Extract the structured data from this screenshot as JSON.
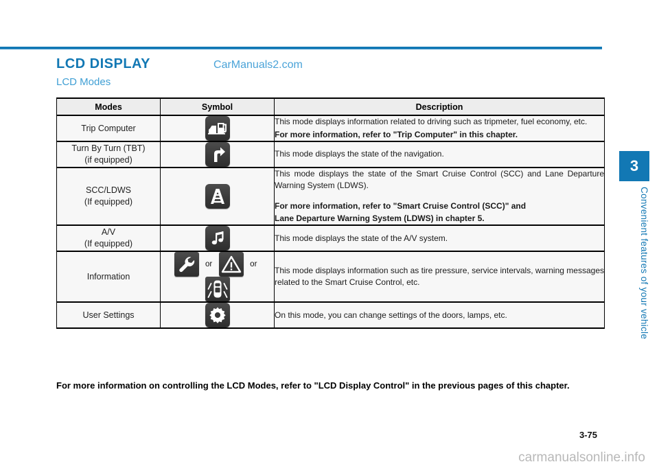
{
  "header": {
    "main_title": "LCD DISPLAY",
    "sub_title": "LCD Modes",
    "watermark_top": "CarManuals2.com",
    "accent_color": "#1278b4"
  },
  "table": {
    "columns": [
      "Modes",
      "Symbol",
      "Description"
    ],
    "rows": [
      {
        "mode": "Trip Computer",
        "mode_sub": "",
        "symbols": [
          "fuel-pump-icon"
        ],
        "desc_lines": [
          {
            "text": "This mode displays information related to driving such as tripmeter, fuel economy, etc.",
            "bold": false
          },
          {
            "text": "For more information, refer to \"Trip Computer\" in this chapter.",
            "bold": true
          }
        ]
      },
      {
        "mode": "Turn By Turn (TBT)",
        "mode_sub": "(if equipped)",
        "symbols": [
          "turn-right-arrow-icon"
        ],
        "desc_lines": [
          {
            "text": "This mode displays the state of the navigation.",
            "bold": false
          }
        ]
      },
      {
        "mode": "SCC/LDWS",
        "mode_sub": "(If equipped)",
        "symbols": [
          "lane-road-icon"
        ],
        "desc_lines": [
          {
            "text": "This mode displays the state of the Smart Cruise Control (SCC) and Lane Departure Warning System (LDWS).",
            "bold": false
          },
          {
            "text": "For more information, refer to \"Smart Cruise Control (SCC)\" and",
            "bold": true,
            "gap": true
          },
          {
            "text": "Lane Departure Warning System (LDWS) in chapter 5.",
            "bold": true
          }
        ]
      },
      {
        "mode": "A/V",
        "mode_sub": "(If equipped)",
        "symbols": [
          "music-note-icon"
        ],
        "desc_lines": [
          {
            "text": "This mode displays the state of the A/V system.",
            "bold": false
          }
        ]
      },
      {
        "mode": "Information",
        "mode_sub": "",
        "symbols": [
          "wrench-icon",
          "warning-triangle-icon",
          "car-topview-icon"
        ],
        "symbol_separator": "or",
        "desc_lines": [
          {
            "text": "This mode displays information such as tire pressure, service intervals, warning messages related to the Smart Cruise Control, etc.",
            "bold": false
          }
        ]
      },
      {
        "mode": "User Settings",
        "mode_sub": "",
        "symbols": [
          "gear-icon"
        ],
        "desc_lines": [
          {
            "text": "On this mode, you can change settings of the doors, lamps, etc.",
            "bold": false
          }
        ]
      }
    ]
  },
  "bottom_note": "For more information on controlling the LCD Modes, refer to \"LCD Display Control\" in the previous pages of this chapter.",
  "chapter": {
    "number": "3",
    "label": "Convenient features of your vehicle"
  },
  "footer": {
    "page_number": "3-75",
    "watermark": "carmanualsonline.info"
  }
}
